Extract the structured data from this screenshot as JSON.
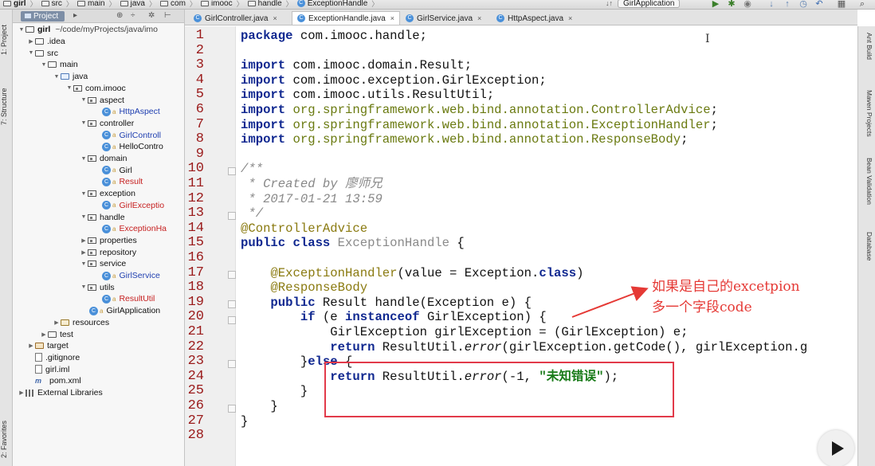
{
  "breadcrumb": [
    "girl",
    "src",
    "main",
    "java",
    "com",
    "imooc",
    "handle",
    "ExceptionHandle"
  ],
  "run_config": "GirlApplication",
  "left_strip": [
    "1: Project",
    "7: Structure",
    "2: Favorites"
  ],
  "right_strip": [
    "Ant Build",
    "Maven Projects",
    "Bean Validation",
    "Database"
  ],
  "project": {
    "tab": "Project",
    "root_label": "girl",
    "root_path": "~/code/myProjects/java/imo",
    "items": [
      ".idea",
      "src",
      "main",
      "java",
      "com.imooc",
      "aspect",
      "HttpAspect",
      "controller",
      "GirlControll",
      "HelloContro",
      "domain",
      "Girl",
      "Result",
      "exception",
      "GirlExceptio",
      "handle",
      "ExceptionHa",
      "properties",
      "repository",
      "service",
      "GirlService",
      "utils",
      "ResultUtil",
      "GirlApplication",
      "resources",
      "test",
      "target",
      ".gitignore",
      "girl.iml",
      "pom.xml",
      "External Libraries"
    ]
  },
  "tabs": [
    {
      "label": "GirlController.java",
      "active": false
    },
    {
      "label": "ExceptionHandle.java",
      "active": true
    },
    {
      "label": "GirlService.java",
      "active": false
    },
    {
      "label": "HttpAspect.java",
      "active": false
    }
  ],
  "line_numbers": [
    "1",
    "2",
    "3",
    "4",
    "5",
    "6",
    "7",
    "8",
    "9",
    "10",
    "11",
    "12",
    "13",
    "14",
    "15",
    "16",
    "17",
    "18",
    "19",
    "20",
    "21",
    "22",
    "23",
    "24",
    "25",
    "26",
    "27",
    "28"
  ],
  "code": {
    "l1a": "package",
    "l1b": " com.imooc.handle;",
    "l3a": "import",
    "l3b": " com.imooc.domain.Result;",
    "l4a": "import",
    "l4b": " com.imooc.exception.GirlException;",
    "l5a": "import",
    "l5b": " com.imooc.utils.ResultUtil;",
    "l6a": "import",
    "l6b": " org.springframework.web.bind.annotation.ControllerAdvice",
    "l6c": ";",
    "l7a": "import",
    "l7b": " org.springframework.web.bind.annotation.ExceptionHandler",
    "l7c": ";",
    "l8a": "import",
    "l8b": " org.springframework.web.bind.annotation.ResponseBody",
    "l8c": ";",
    "l10": "/**",
    "l11": " * Created by 廖师兄",
    "l12": " * 2017-01-21 13:59",
    "l13": " */",
    "l14": "@ControllerAdvice",
    "l15a": "public class",
    "l15b": " ExceptionHandle",
    "l15c": " {",
    "l17a": "    ",
    "l17b": "@ExceptionHandler",
    "l17c": "(value = Exception.",
    "l17d": "class",
    "l17e": ")",
    "l18a": "    ",
    "l18b": "@ResponseBody",
    "l19a": "    public",
    "l19b": " Result handle(Exception e) {",
    "l20a": "        if",
    "l20b": " (e ",
    "l20c": "instanceof",
    "l20d": " GirlException) {",
    "l21": "            GirlException girlException = (GirlException) e;",
    "l22a": "            return",
    "l22b": " ResultUtil.",
    "l22c": "error",
    "l22d": "(girlException.getCode(), girlException.g",
    "l23a": "        }",
    "l23b": "else",
    "l23c": " {",
    "l24a": "            return",
    "l24b": " ResultUtil.",
    "l24c": "error",
    "l24d": "(-1, ",
    "l24e": "\"未知错误\"",
    "l24f": ");",
    "l25": "        }",
    "l26": "    }",
    "l27": "}"
  },
  "annotation": {
    "text": "如果是自己的excetpion\n多一个字段code",
    "color": "#e53935"
  },
  "colors": {
    "keyword": "#102890",
    "annotation": "#8a7a10",
    "string": "#177a17",
    "line_number": "#9a1a1a",
    "highlight_box": "#e23a4a"
  }
}
